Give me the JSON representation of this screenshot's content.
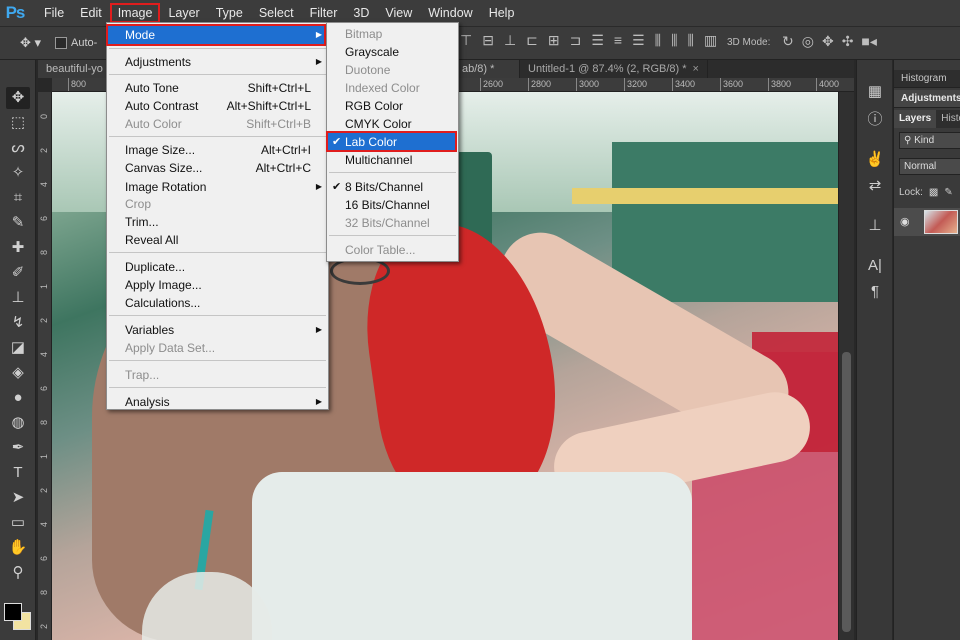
{
  "app": {
    "logo": "Ps"
  },
  "menubar": {
    "items": [
      "File",
      "Edit",
      "Image",
      "Layer",
      "Type",
      "Select",
      "Filter",
      "3D",
      "View",
      "Window",
      "Help"
    ]
  },
  "options": {
    "auto_label": "Auto-",
    "mode3d_label": "3D Mode:"
  },
  "doc_tabs": [
    {
      "label": "beautiful-yo"
    },
    {
      "label": "ab/8) *"
    },
    {
      "label": "Untitled-1 @ 87.4% (2, RGB/8) *"
    }
  ],
  "ruler": {
    "top": [
      "800",
      "2600",
      "2800",
      "3000",
      "3200",
      "3400",
      "3600",
      "3800",
      "4000"
    ],
    "left": [
      "0",
      "2",
      "4",
      "6",
      "8",
      "1",
      "2",
      "4",
      "6",
      "8",
      "1",
      "2",
      "4",
      "6",
      "8",
      "2"
    ]
  },
  "image_menu": {
    "items": [
      {
        "label": "Mode",
        "arrow": true,
        "highlighted": true
      },
      {
        "label": "Adjustments",
        "arrow": true
      },
      {
        "label": "Auto Tone",
        "shortcut": "Shift+Ctrl+L"
      },
      {
        "label": "Auto Contrast",
        "shortcut": "Alt+Shift+Ctrl+L"
      },
      {
        "label": "Auto Color",
        "shortcut": "Shift+Ctrl+B",
        "disabled": true
      },
      {
        "label": "Image Size...",
        "shortcut": "Alt+Ctrl+I"
      },
      {
        "label": "Canvas Size...",
        "shortcut": "Alt+Ctrl+C"
      },
      {
        "label": "Image Rotation",
        "arrow": true
      },
      {
        "label": "Crop",
        "disabled": true
      },
      {
        "label": "Trim..."
      },
      {
        "label": "Reveal All"
      },
      {
        "label": "Duplicate..."
      },
      {
        "label": "Apply Image..."
      },
      {
        "label": "Calculations..."
      },
      {
        "label": "Variables",
        "arrow": true
      },
      {
        "label": "Apply Data Set...",
        "disabled": true
      },
      {
        "label": "Trap...",
        "disabled": true
      },
      {
        "label": "Analysis",
        "arrow": true
      }
    ]
  },
  "mode_menu": {
    "items": [
      {
        "label": "Bitmap",
        "disabled": true
      },
      {
        "label": "Grayscale"
      },
      {
        "label": "Duotone",
        "disabled": true
      },
      {
        "label": "Indexed Color",
        "disabled": true
      },
      {
        "label": "RGB Color"
      },
      {
        "label": "CMYK Color"
      },
      {
        "label": "Lab Color",
        "checked": true,
        "highlighted": true
      },
      {
        "label": "Multichannel"
      },
      {
        "label": "8 Bits/Channel",
        "checked": true
      },
      {
        "label": "16 Bits/Channel"
      },
      {
        "label": "32 Bits/Channel",
        "disabled": true
      },
      {
        "label": "Color Table...",
        "disabled": true
      }
    ]
  },
  "panels": {
    "histogram": "Histogram",
    "adjustments": "Adjustments",
    "layers_tab": "Layers",
    "history_tab": "Histo",
    "kind": "Kind",
    "blend_mode": "Normal",
    "lock_label": "Lock:"
  },
  "colors": {
    "highlight": "#1e6fd1",
    "callout": "#e01d1d",
    "foreground": "#000000",
    "background": "#f2e3a2"
  }
}
